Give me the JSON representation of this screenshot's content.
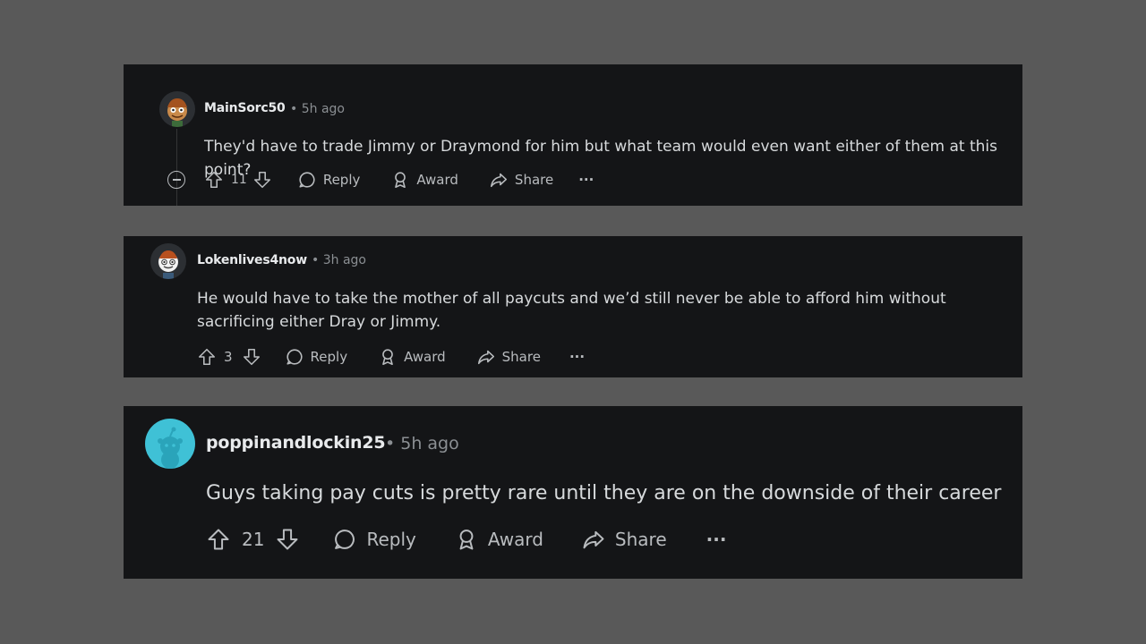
{
  "comments": [
    {
      "username": "MainSorc50",
      "time": "• 5h ago",
      "text": "They'd have to trade Jimmy or Draymond for him but what team would even want either of them at this point?",
      "votes": "11",
      "reply_label": "Reply",
      "award_label": "Award",
      "share_label": "Share",
      "more_label": "···"
    },
    {
      "username": "Lokenlives4now",
      "time": "• 3h ago",
      "text": "He would have to take the mother of all paycuts and we’d still never be able to afford him without sacrificing either Dray or Jimmy.",
      "votes": "3",
      "reply_label": "Reply",
      "award_label": "Award",
      "share_label": "Share",
      "more_label": "···"
    },
    {
      "username": "poppinandlockin25",
      "time": "• 5h ago",
      "text": "Guys taking pay cuts is pretty rare until they are on the downside of their career",
      "votes": "21",
      "reply_label": "Reply",
      "award_label": "Award",
      "share_label": "Share",
      "more_label": "···"
    }
  ],
  "colors": {
    "background": "#595959",
    "card": "#141517",
    "text": "#d7dadc",
    "muted": "#8b8f93",
    "avatar3": "#3fc1d6"
  }
}
